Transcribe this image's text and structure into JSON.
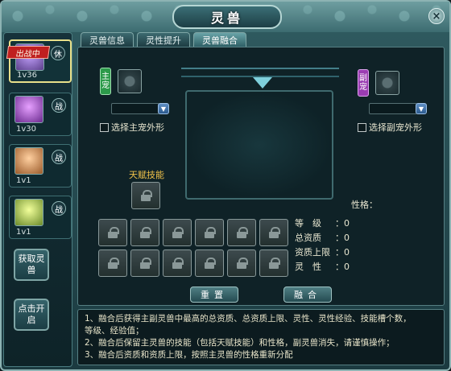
{
  "window": {
    "title": "灵兽",
    "close_label": "×"
  },
  "tabs": [
    {
      "label": "灵兽信息",
      "active": false
    },
    {
      "label": "灵性提升",
      "active": false
    },
    {
      "label": "灵兽融合",
      "active": true
    }
  ],
  "pets": [
    {
      "level": "1v36",
      "state": "休",
      "ribbon": "出战中",
      "active": true,
      "color": "#7a5fb8"
    },
    {
      "level": "1v30",
      "state": "战",
      "ribbon": "",
      "active": false,
      "color": "#8b4fb5"
    },
    {
      "level": "1v1",
      "state": "战",
      "ribbon": "",
      "active": false,
      "color": "#d08a3c"
    },
    {
      "level": "1v1",
      "state": "战",
      "ribbon": "",
      "active": false,
      "color": "#b8c43c"
    }
  ],
  "side_buttons": {
    "get_pet": "获取灵兽",
    "open": "点击开启"
  },
  "main_pet": {
    "tag": "主宠",
    "checkbox_label": "选择主宠外形",
    "tag_color": "#2c9a4a"
  },
  "sub_pet": {
    "tag": "副宠",
    "checkbox_label": "选择副宠外形",
    "tag_color": "#9a3cb2"
  },
  "talent_label": "天赋技能",
  "personality_label": "性格：",
  "stats": [
    {
      "label": "等　级",
      "value": "：0"
    },
    {
      "label": "总资质",
      "value": "：0"
    },
    {
      "label": "资质上限",
      "value": "：0"
    },
    {
      "label": "灵　性",
      "value": "：0"
    }
  ],
  "buttons": {
    "reset": "重置",
    "fuse": "融合"
  },
  "notes": [
    "1、融合后获得主副灵兽中最高的总资质、总资质上限、灵性、灵性经验、技能槽个数，",
    "等级、经验值；",
    "2、融合后保留主灵兽的技能（包括天赋技能）和性格，副灵兽消失，请谨慎操作；",
    "3、融合后资质和资质上限，按照主灵兽的性格重新分配"
  ]
}
